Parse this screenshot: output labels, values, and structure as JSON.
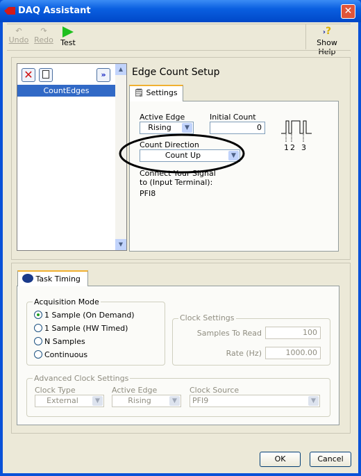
{
  "window": {
    "title": "DAQ Assistant",
    "close_icon": "close-icon"
  },
  "toolbar": {
    "undo": "Undo",
    "redo": "Redo",
    "test": "Test",
    "show_help": "Show Help"
  },
  "task_list": {
    "items": [
      "CountEdges"
    ],
    "selected": "CountEdges"
  },
  "setup": {
    "title": "Edge Count Setup",
    "settings_tab": "Settings",
    "active_edge_label": "Active Edge",
    "active_edge": "Rising",
    "initial_count_label": "Initial Count",
    "initial_count": "0",
    "count_direction_label": "Count Direction",
    "count_direction": "Count Up",
    "connect_label": "Connect Your Signal to (Input Terminal):",
    "terminal": "PFI8",
    "diagram_labels": [
      "1",
      "2",
      "3"
    ]
  },
  "timing": {
    "tab": "Task Timing",
    "acq_mode_label": "Acquisition Mode",
    "modes": [
      {
        "label": "1 Sample (On Demand)",
        "selected": true
      },
      {
        "label": "1 Sample (HW Timed)",
        "selected": false
      },
      {
        "label": "N Samples",
        "selected": false
      },
      {
        "label": "Continuous",
        "selected": false
      }
    ],
    "clock_settings_label": "Clock Settings",
    "samples_label": "Samples To Read",
    "samples": "100",
    "rate_label": "Rate (Hz)",
    "rate": "1000.00",
    "adv_label": "Advanced Clock Settings",
    "clock_type_label": "Clock Type",
    "clock_type": "External",
    "adv_edge_label": "Active Edge",
    "adv_edge": "Rising",
    "clock_source_label": "Clock Source",
    "clock_source": "PFI9"
  },
  "buttons": {
    "ok": "OK",
    "cancel": "Cancel"
  }
}
